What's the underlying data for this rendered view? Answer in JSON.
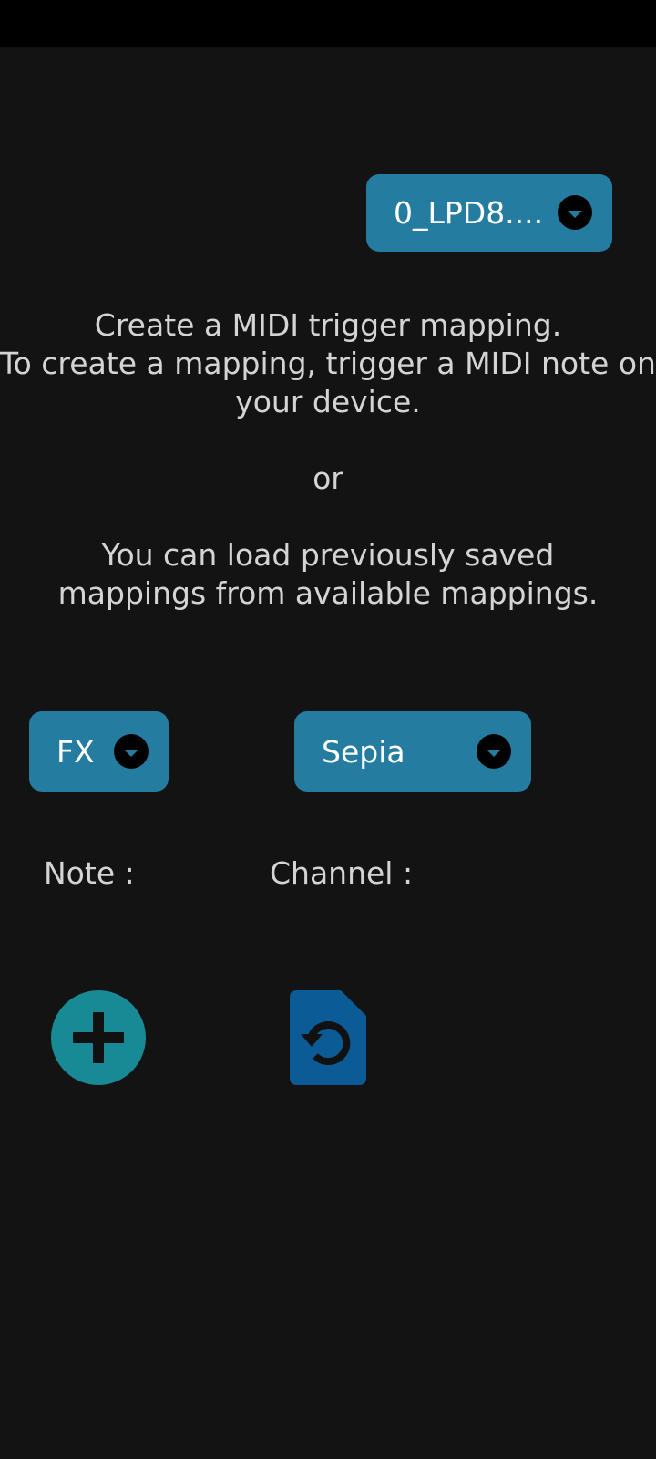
{
  "device_select": {
    "value": "0_LPD8....",
    "icon": "dropdown-caret-icon"
  },
  "info": {
    "line1": "Create a MIDI trigger mapping.",
    "line2": "To create a mapping, trigger a MIDI note on your device.",
    "line3": "or",
    "line4": "You can load previously saved mappings from available mappings."
  },
  "type_select": {
    "value": "FX",
    "icon": "dropdown-caret-icon"
  },
  "effect_select": {
    "value": "Sepia",
    "icon": "dropdown-caret-icon"
  },
  "labels": {
    "note": "Note :",
    "channel": "Channel :"
  },
  "actions": {
    "add_icon": "plus-icon",
    "load_icon": "file-restore-icon"
  },
  "colors": {
    "background": "#131313",
    "status_bar": "#000000",
    "dropdown": "#247ca1",
    "add_button": "#178a95",
    "load_button": "#0b5b97",
    "text": "#d4d4d4"
  }
}
